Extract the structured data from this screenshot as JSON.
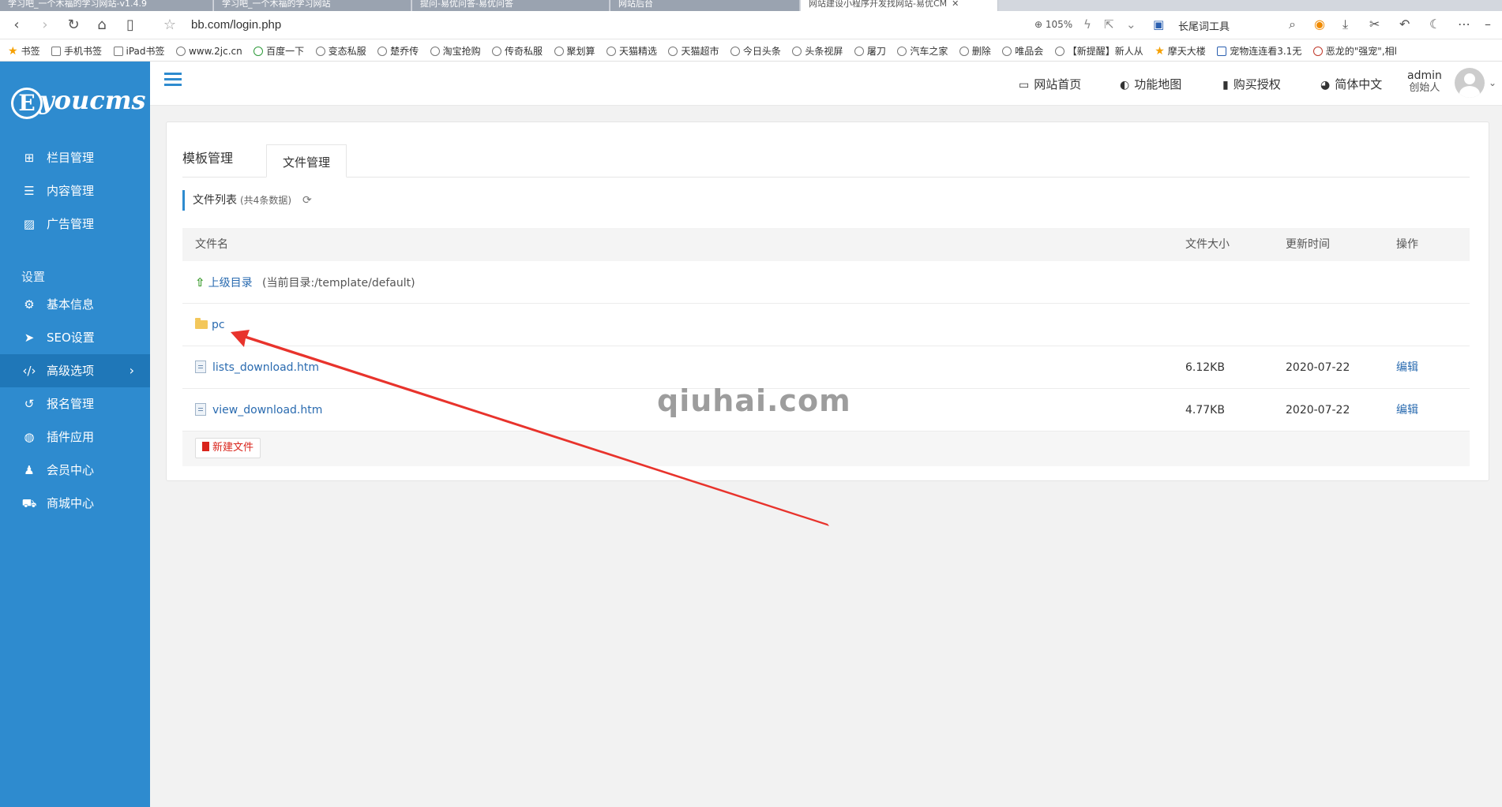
{
  "browser": {
    "tabs": [
      {
        "title": "学习吧_一个木福的学习网站-v1.4.9"
      },
      {
        "title": "学习吧_一个木福的学习网站"
      },
      {
        "title": "提问-易优问答-易优问答"
      },
      {
        "title": "网站后台"
      },
      {
        "title": "网站建设小程序开发找网站-易优CM"
      }
    ],
    "address": "bb.com/login.php",
    "zoom": "105%",
    "longtail_tool": "长尾词工具",
    "bookmarks": [
      "书签",
      "手机书签",
      "iPad书签",
      "www.2jc.cn",
      "百度一下",
      "变态私服",
      "楚乔传",
      "淘宝抢购",
      "传奇私服",
      "聚划算",
      "天猫精选",
      "天猫超市",
      "今日头条",
      "头条视屏",
      "屠刀",
      "汽车之家",
      "删除",
      "唯品会",
      "【新提醒】新人从",
      "摩天大楼",
      "宠物连连看3.1无",
      "恶龙的\"强宠\",相l"
    ]
  },
  "sidebar": {
    "logo": "youcms",
    "logo_letter": "E",
    "items": [
      {
        "label": "栏目管理",
        "icon": "sitemap-icon"
      },
      {
        "label": "内容管理",
        "icon": "list-icon"
      },
      {
        "label": "广告管理",
        "icon": "image-icon"
      }
    ],
    "section_label": "设置",
    "settings_items": [
      {
        "label": "基本信息",
        "icon": "gear-icon"
      },
      {
        "label": "SEO设置",
        "icon": "paper-plane-icon"
      },
      {
        "label": "高级选项",
        "icon": "code-icon"
      },
      {
        "label": "报名管理",
        "icon": "refresh-icon"
      },
      {
        "label": "插件应用",
        "icon": "soccer-icon"
      },
      {
        "label": "会员中心",
        "icon": "user-icon"
      },
      {
        "label": "商城中心",
        "icon": "cart-icon"
      }
    ],
    "accent": "#2e8bcf"
  },
  "topbar": {
    "links": [
      "网站首页",
      "功能地图",
      "购买授权",
      "简体中文"
    ],
    "user": "admin",
    "role": "创始人"
  },
  "panel": {
    "tabs": [
      "模板管理",
      "文件管理"
    ],
    "list_title": "文件列表",
    "list_count": "(共4条数据)",
    "columns": {
      "name": "文件名",
      "size": "文件大小",
      "time": "更新时间",
      "op": "操作"
    },
    "parent": {
      "label": "上级目录",
      "current": "(当前目录:/template/default)"
    },
    "folder": "pc",
    "files": [
      {
        "name": "lists_download.htm",
        "size": "6.12KB",
        "time": "2020-07-22",
        "op": "编辑"
      },
      {
        "name": "view_download.htm",
        "size": "4.77KB",
        "time": "2020-07-22",
        "op": "编辑"
      }
    ],
    "new_file": "新建文件"
  },
  "watermark": "qiuhai.com",
  "annotation_color": "#e8332c"
}
